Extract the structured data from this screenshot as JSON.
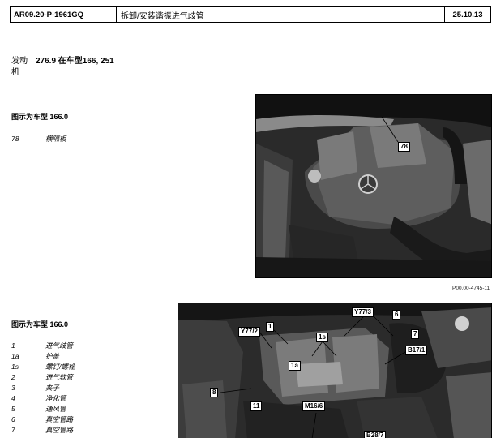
{
  "header": {
    "doc_id": "AR09.20-P-1961GQ",
    "title": "拆卸/安装谐振进气歧管",
    "date": "25.10.13"
  },
  "applies_to": {
    "label": "发动机",
    "value": "276.9 在车型166, 251"
  },
  "figure1": {
    "title": "图示为车型 166.0",
    "legend": [
      {
        "num": "78",
        "text": "横隔板"
      }
    ],
    "callouts": [
      "78"
    ],
    "code": "P00.00-4745-11"
  },
  "figure2": {
    "title": "图示为车型 166.0",
    "legend": [
      {
        "num": "1",
        "text": "进气歧管"
      },
      {
        "num": "1a",
        "text": "护盖"
      },
      {
        "num": "1s",
        "text": "螺钉/螺栓"
      },
      {
        "num": "2",
        "text": "进气软管"
      },
      {
        "num": "3",
        "text": "夹子"
      },
      {
        "num": "4",
        "text": "净化管"
      },
      {
        "num": "5",
        "text": "通风管"
      },
      {
        "num": "6",
        "text": "真空管路"
      },
      {
        "num": "7",
        "text": "真空管路"
      }
    ],
    "callouts": [
      "Y77/3",
      "6",
      "Y77/2",
      "1",
      "1s",
      "7",
      "B17/1",
      "1a",
      "8",
      "11",
      "M16/6",
      "B28/7"
    ]
  }
}
